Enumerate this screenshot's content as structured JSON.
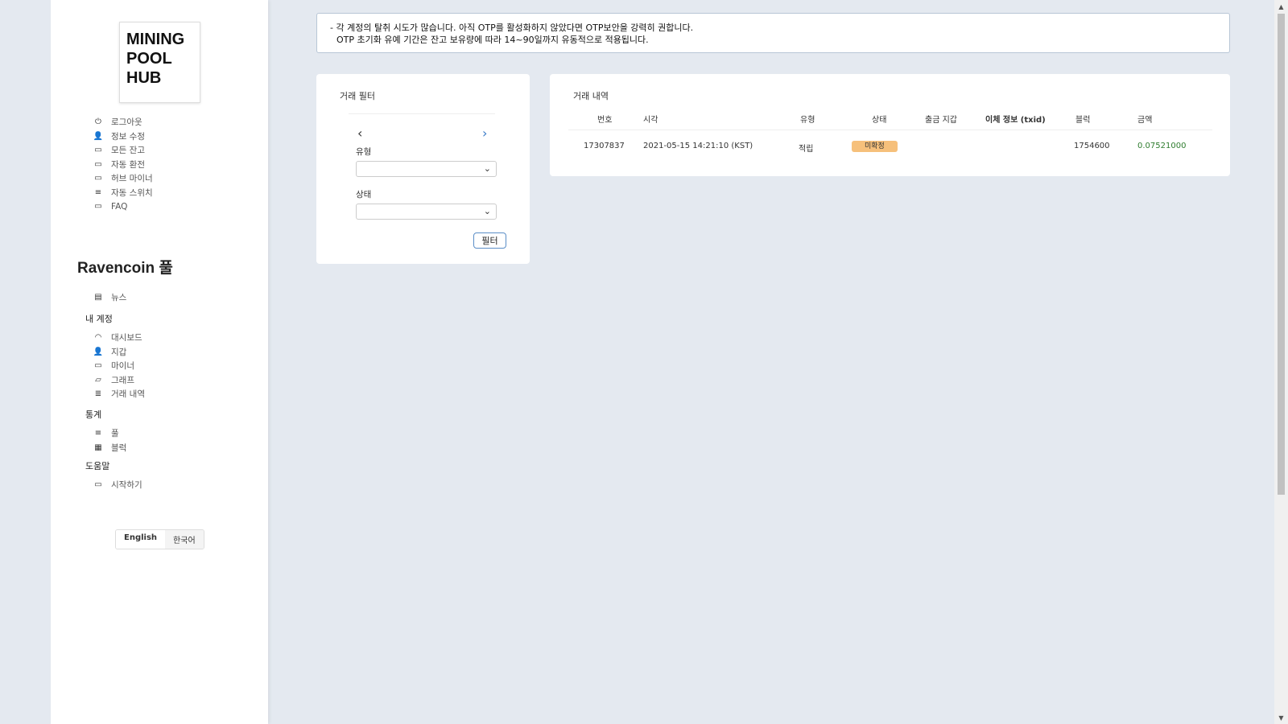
{
  "logo": {
    "line1": "MINING",
    "line2": "POOL",
    "line3": "HUB"
  },
  "top_nav": [
    {
      "label": "로그아웃",
      "icon": "⏻"
    },
    {
      "label": "정보 수정",
      "icon": "👤"
    },
    {
      "label": "모든 잔고",
      "icon": "▭"
    },
    {
      "label": "자동 환전",
      "icon": "▭"
    },
    {
      "label": "허브 마이너",
      "icon": "▭"
    },
    {
      "label": "자동 스위치",
      "icon": "≡"
    },
    {
      "label": "FAQ",
      "icon": "▭"
    }
  ],
  "pool_title": "Ravencoin 풀",
  "news": {
    "label": "뉴스",
    "icon": "▤"
  },
  "account": {
    "heading": "내 계정",
    "items": [
      {
        "label": "대시보드",
        "icon": "◠"
      },
      {
        "label": "지갑",
        "icon": "👤"
      },
      {
        "label": "마이너",
        "icon": "▭"
      },
      {
        "label": "그래프",
        "icon": "▱"
      },
      {
        "label": "거래 내역",
        "icon": "≣"
      }
    ]
  },
  "stats": {
    "heading": "통계",
    "items": [
      {
        "label": "풀",
        "icon": "≡"
      },
      {
        "label": "블럭",
        "icon": "▦"
      }
    ]
  },
  "help": {
    "heading": "도움말",
    "items": [
      {
        "label": "시작하기",
        "icon": "▭"
      }
    ]
  },
  "language": {
    "english": "English",
    "korean": "한국어"
  },
  "alert": {
    "line1": "- 각 계정의 탈취 시도가 많습니다. 아직 OTP를 활성화하지 않았다면 OTP보안을 강력히 권합니다.",
    "line2": "OTP 초기화 유예 기간은 잔고 보유량에 따라 14~90일까지 유동적으로 적용됩니다."
  },
  "filter": {
    "title": "거래 필터",
    "prev_icon": "‹",
    "next_icon": "›",
    "type_label": "유형",
    "type_value": "",
    "status_label": "상태",
    "status_value": "",
    "button": "필터"
  },
  "transactions": {
    "title": "거래 내역",
    "columns": [
      "번호",
      "시각",
      "유형",
      "상태",
      "출금 지갑",
      "이체 정보 (txid)",
      "블럭",
      "금액"
    ],
    "rows": [
      {
        "id": "17307837",
        "time": "2021-05-15 14:21:10 (KST)",
        "type": "적립",
        "status": "미확정",
        "wallet": "",
        "txid": "",
        "block": "1754600",
        "amount": "0.07521000"
      }
    ]
  }
}
